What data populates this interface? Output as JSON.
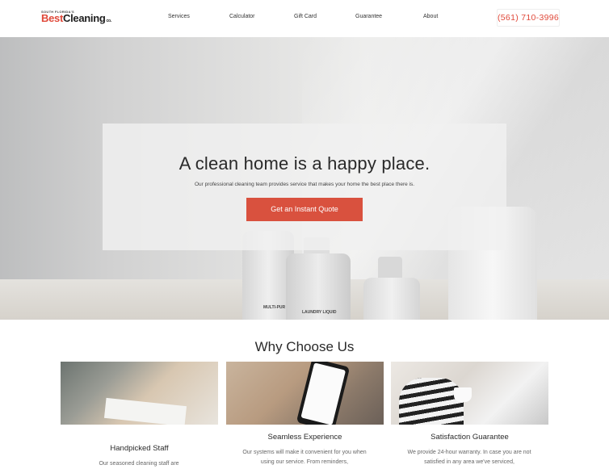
{
  "header": {
    "logo": {
      "top": "SOUTH FLORIDA'S",
      "best": "Best",
      "cleaning": "Cleaning",
      "co": "co."
    },
    "nav": [
      "Services",
      "Calculator",
      "Gift Card",
      "Guarantee",
      "About"
    ],
    "phone": "(561) 710-3996"
  },
  "hero": {
    "title": "A clean home is a happy place.",
    "subtitle": "Our professional cleaning team provides service that makes your home the best place there is.",
    "cta": "Get an Instant Quote",
    "bottle_labels": [
      "MULTI-PUR CLEANER",
      "LAUNDRY LIQUID"
    ]
  },
  "why": {
    "title": "Why Choose Us",
    "features": [
      {
        "title": "Handpicked Staff",
        "text": "Our seasoned cleaning staff are"
      },
      {
        "title": "Seamless Experience",
        "text": "Our systems will make it convenient for you when using our service. From reminders,"
      },
      {
        "title": "Satisfaction Guarantee",
        "text": "We provide 24-hour warranty. In case you are not satisfied in any area we've serviced,"
      }
    ]
  },
  "colors": {
    "accent": "#d9513e",
    "brand_red": "#e0493a"
  }
}
